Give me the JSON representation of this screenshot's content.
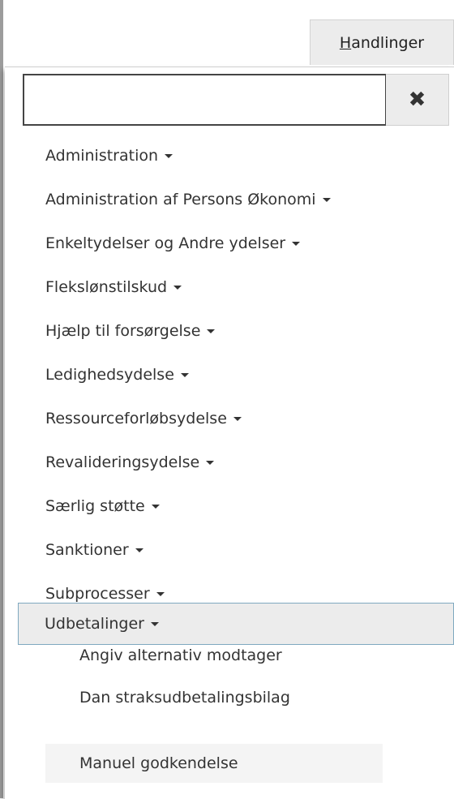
{
  "header": {
    "actions_tab": {
      "hotkey": "H",
      "rest": "andlinger"
    }
  },
  "search": {
    "value": "",
    "placeholder": "",
    "clear_icon": "close-icon"
  },
  "menu": {
    "items": [
      {
        "label": "Administration"
      },
      {
        "label": "Administration af Persons Økonomi"
      },
      {
        "label": "Enkeltydelser og Andre ydelser"
      },
      {
        "label": "Flekslønstilskud"
      },
      {
        "label": "Hjælp til forsørgelse"
      },
      {
        "label": "Ledighedsydelse"
      },
      {
        "label": "Ressourceforløbsydelse"
      },
      {
        "label": "Revalideringsydelse"
      },
      {
        "label": "Særlig støtte"
      },
      {
        "label": "Sanktioner"
      },
      {
        "label": "Subprocesser"
      },
      {
        "label": "Udbetalinger"
      }
    ],
    "expanded_item": "Udbetalinger",
    "subitems": [
      {
        "label": "Angiv alternativ modtager"
      },
      {
        "label": "Dan straksudbetalingsbilag"
      },
      {
        "label": "Manuel godkendelse"
      }
    ],
    "hovered_subitem": "Manuel godkendelse"
  },
  "colors": {
    "accent_border": "#7fa9c0",
    "tab_bg": "#ececec",
    "text": "#333333"
  }
}
